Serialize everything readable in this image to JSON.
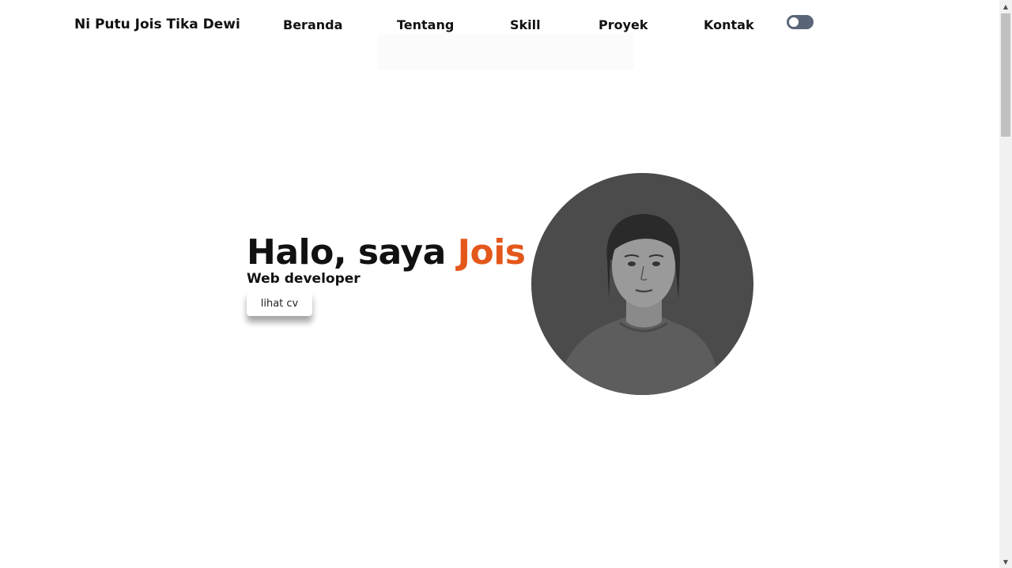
{
  "nav": {
    "brand": "Ni Putu Jois Tika Dewi",
    "links": [
      {
        "label": "Beranda"
      },
      {
        "label": "Tentang"
      },
      {
        "label": "Skill"
      },
      {
        "label": "Proyek"
      },
      {
        "label": "Kontak"
      }
    ],
    "theme_toggle": {
      "state": "off",
      "icon": "toggle-switch-icon"
    }
  },
  "hero": {
    "greeting": "Halo, saya",
    "name": "Jois",
    "role": "Web developer",
    "cv_button_label": "lihat cv"
  },
  "colors": {
    "accent": "#e4571b",
    "toggle": "#5a6678",
    "avatar_bg": "#4b4b4b"
  },
  "scrollbar": {
    "up_icon": "scroll-up-arrow-icon",
    "down_icon": "scroll-down-arrow-icon"
  }
}
